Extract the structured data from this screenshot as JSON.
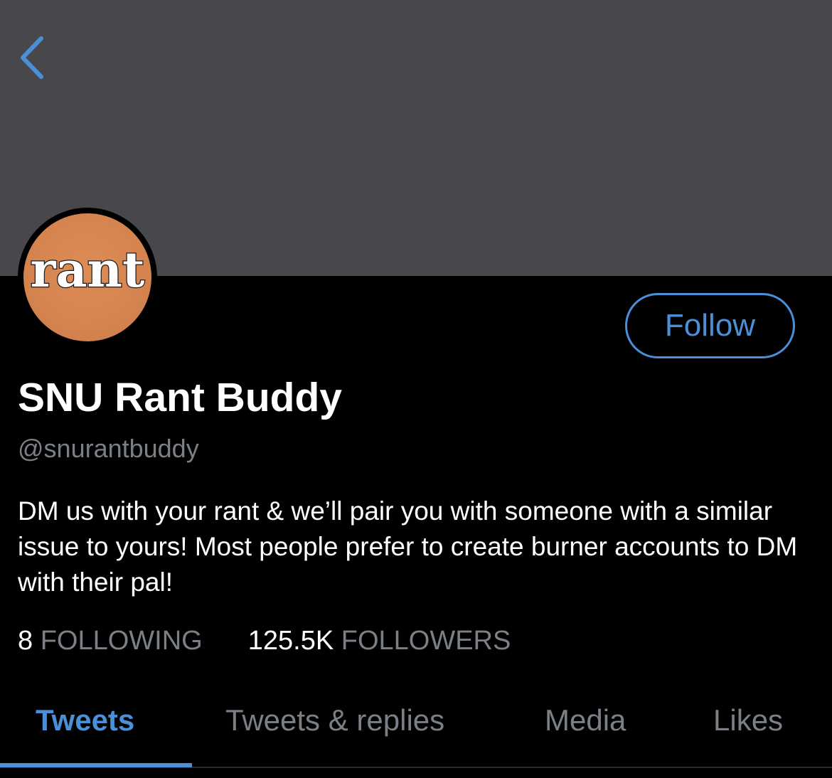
{
  "profile": {
    "avatar_text": "rant",
    "display_name": "SNU Rant Buddy",
    "handle": "@snurantbuddy",
    "bio": "DM us with your rant & we’ll pair you with someone with a similar issue to yours! Most people prefer to create burner accounts to DM with their pal!",
    "follow_label": "Follow"
  },
  "stats": {
    "following_count": "8",
    "following_label": "FOLLOWING",
    "followers_count": "125.5K",
    "followers_label": "FOLLOWERS"
  },
  "tabs": [
    {
      "label": "Tweets",
      "active": true
    },
    {
      "label": "Tweets & replies",
      "active": false
    },
    {
      "label": "Media",
      "active": false
    },
    {
      "label": "Likes",
      "active": false
    }
  ],
  "icons": {
    "back": "chevron-left-icon"
  },
  "colors": {
    "accent": "#4a90d9",
    "banner": "#48484c",
    "background": "#000000",
    "muted_text": "#7b8087",
    "avatar_bg": "#d58450"
  }
}
